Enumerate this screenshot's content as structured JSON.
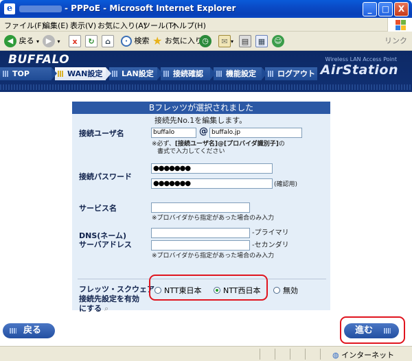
{
  "window": {
    "title": "- PPPoE - Microsoft Internet Explorer",
    "buttons": {
      "minimize": "_",
      "maximize": "□",
      "close": "X"
    }
  },
  "menu": [
    "ファイル(F)",
    "編集(E)",
    "表示(V)",
    "お気に入り(A)",
    "ツール(T)",
    "ヘルプ(H)"
  ],
  "toolbar": {
    "back": "戻る",
    "search": "検索",
    "favorites": "お気に入り",
    "links": "リンク"
  },
  "header": {
    "brand": "BUFFALO",
    "product_sub": "Wireless LAN Access Point",
    "product": "AirStation",
    "nav": [
      "TOP",
      "WAN設定",
      "LAN設定",
      "接続確認",
      "機能設定",
      "ログアウト"
    ],
    "active_nav": "WAN設定"
  },
  "form": {
    "panel_title": "Bフレッツが選択されました",
    "editing_text": "接続先No.1を編集します。",
    "username": {
      "label": "接続ユーザ名",
      "user_value": "buffalo",
      "at": "@",
      "domain_value": "buffalo.jp",
      "note_prefix": "※必ず、",
      "note_bold": "[接続ユーザ名]@[プロバイダ識別子]",
      "note_suffix": "の",
      "note_line2": "書式で入力してください"
    },
    "password": {
      "label": "接続パスワード",
      "value": "●●●●●●●",
      "confirm_value": "●●●●●●●",
      "confirm_label": "(確認用)"
    },
    "service": {
      "label": "サービス名",
      "value": "",
      "note": "※プロバイダから指定があった場合のみ入力"
    },
    "dns": {
      "label_line1": "DNS(ネーム)",
      "label_line2": "サーバアドレス",
      "primary_label": "-プライマリ",
      "secondary_label": "-セカンダリ",
      "note": "※プロバイダから指定があった場合のみ入力"
    },
    "flets": {
      "label_line1": "フレッツ・スクウェア",
      "label_line2": "接続先設定を有効",
      "label_line3": "にする",
      "options": [
        "NTT東日本",
        "NTT西日本",
        "無効"
      ],
      "selected": "NTT西日本"
    }
  },
  "buttons": {
    "back": "戻る",
    "next": "進む"
  },
  "status": {
    "zone": "インターネット"
  },
  "colors": {
    "header_bg": "#0d2a66",
    "panel_bg": "#e4eef8",
    "panel_title_bg": "#2b58a5",
    "highlight_border": "#e0141e",
    "button_bg": "#2350a2"
  }
}
